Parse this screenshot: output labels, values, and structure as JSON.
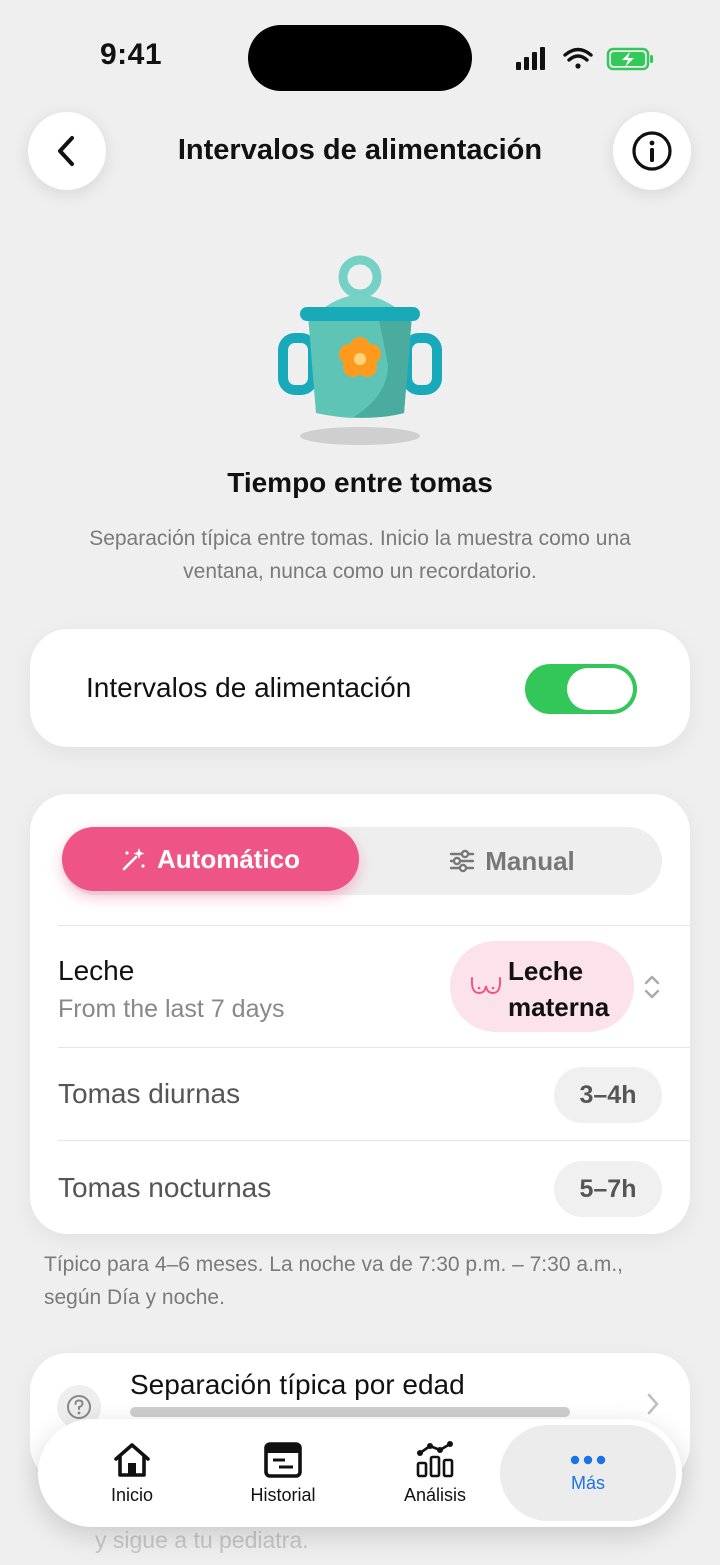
{
  "status_bar": {
    "time": "9:41"
  },
  "header": {
    "title": "Intervalos de alimentación"
  },
  "hero": {
    "heading": "Tiempo entre tomas",
    "description": "Separación típica entre tomas. Inicio la muestra como una ventana, nunca como un recordatorio."
  },
  "toggle_card": {
    "label": "Intervalos de alimentación",
    "enabled": true
  },
  "mode": {
    "auto_label": "Automático",
    "manual_label": "Manual",
    "selected": "Automático"
  },
  "milk": {
    "title": "Leche",
    "subtitle": "From the last 7 days",
    "type_line1": "Leche",
    "type_line2": "materna"
  },
  "intervals": [
    {
      "label": "Tomas diurnas",
      "value": "3–4h"
    },
    {
      "label": "Tomas nocturnas",
      "value": "5–7h"
    }
  ],
  "note": "Típico para 4–6 meses. La noche va de 7:30 p.m. – 7:30 a.m., según Día y noche.",
  "age_card": {
    "title": "Separación típica por edad",
    "peek_text": "y sigue a tu pediatra."
  },
  "tabbar": {
    "tabs": [
      {
        "label": "Inicio",
        "icon": "home-icon"
      },
      {
        "label": "Historial",
        "icon": "history-icon"
      },
      {
        "label": "Análisis",
        "icon": "analytics-icon"
      },
      {
        "label": "Más",
        "icon": "more-icon"
      }
    ],
    "active": "Más"
  },
  "colors": {
    "accent": "#ef5486",
    "toggle_on": "#33c759",
    "tab_active": "#1a73e8",
    "cup": "#5ec4b6",
    "flower": "#ff9a1f"
  }
}
